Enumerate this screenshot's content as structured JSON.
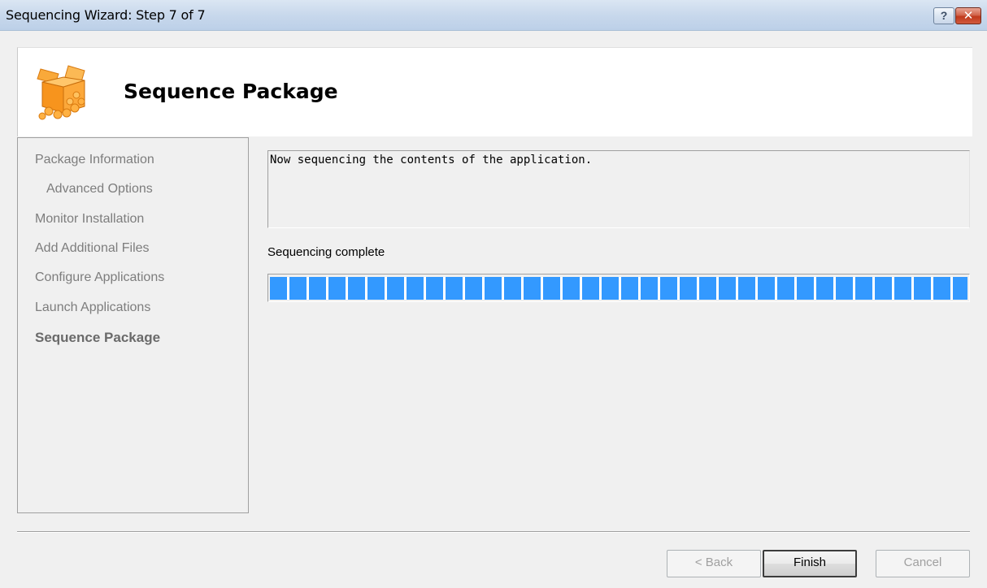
{
  "window": {
    "title": "Sequencing Wizard: Step 7 of 7",
    "help_label": "?",
    "close_label": "✕",
    "icon": "package-box-icon"
  },
  "header": {
    "title": "Sequence Package"
  },
  "nav": {
    "items": [
      {
        "label": "Package Information",
        "state": "completed"
      },
      {
        "label": "Advanced Options",
        "state": "completed"
      },
      {
        "label": "Monitor Installation",
        "state": "completed"
      },
      {
        "label": "Add Additional Files",
        "state": "completed"
      },
      {
        "label": "Configure Applications",
        "state": "completed"
      },
      {
        "label": "Launch Applications",
        "state": "completed"
      },
      {
        "label": "Sequence Package",
        "state": "active"
      }
    ]
  },
  "main": {
    "status_message": "Now sequencing the contents of the application.",
    "progress_label": "Sequencing complete",
    "progress_value": 1.0
  },
  "buttons": {
    "back": "< Back",
    "finish": "Finish",
    "cancel": "Cancel"
  },
  "colors": {
    "progress": "#3399ff",
    "box_orange": "#f7941d"
  }
}
